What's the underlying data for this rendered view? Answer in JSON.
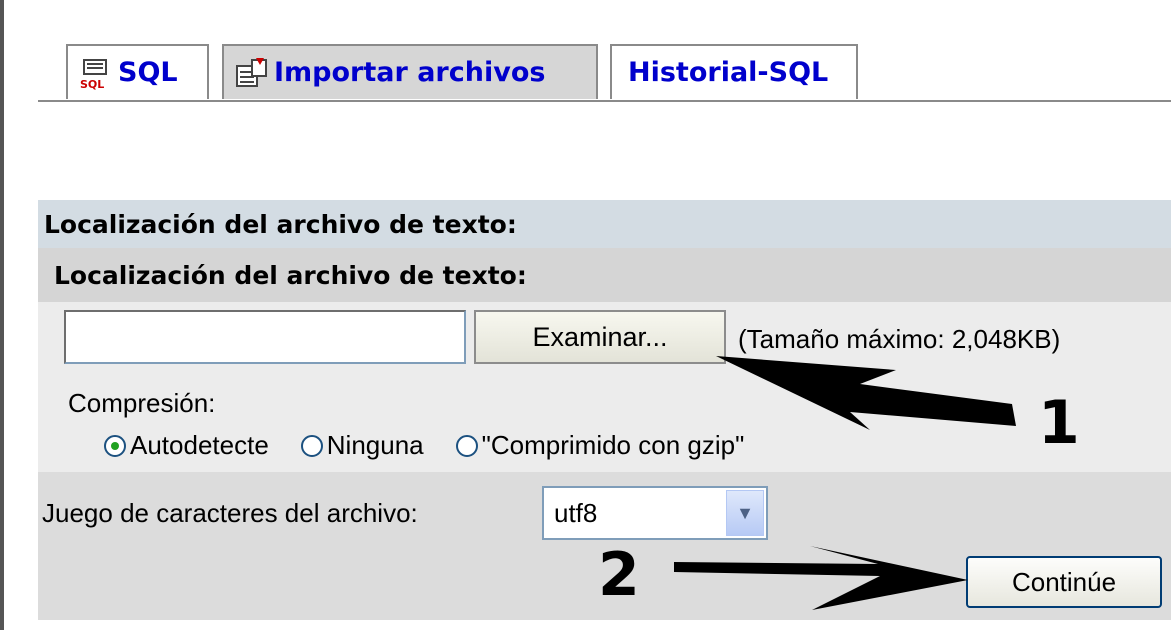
{
  "tabs": [
    {
      "label": "SQL",
      "icon": "sql-icon",
      "active": false
    },
    {
      "label": "Importar archivos",
      "icon": "import-icon",
      "active": true
    },
    {
      "label": "Historial-SQL",
      "active": false
    }
  ],
  "panel": {
    "legend": "Localización del archivo de texto:",
    "section_title": "Localización del archivo de texto:",
    "file_input": {
      "value": ""
    },
    "browse_button": "Examinar...",
    "max_size": "(Tamaño máximo: 2,048KB)",
    "compression_label": "Compresión:",
    "compression_options": [
      {
        "label": "Autodetecte",
        "checked": true
      },
      {
        "label": "Ninguna",
        "checked": false
      },
      {
        "label": "\"Comprimido con gzip\"",
        "checked": false
      }
    ],
    "charset_label": "Juego de caracteres del archivo:",
    "charset_value": "utf8",
    "continue_button": "Continúe"
  },
  "annotations": {
    "step1": "1",
    "step2": "2"
  },
  "colors": {
    "tab_text": "#0000cc",
    "legend_bg": "#d3dce3",
    "panel_bg": "#e5e5e5",
    "radio_selected": "#21a121"
  }
}
